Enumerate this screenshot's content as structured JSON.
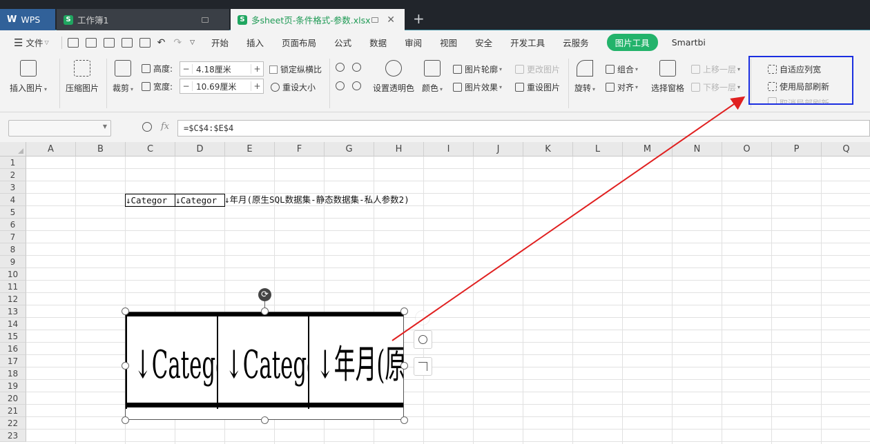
{
  "tabs": {
    "wps": "WPS",
    "book1": "工作簿1",
    "active": "多sheet页-条件格式-参数.xlsx",
    "new_tab_symbol": "+"
  },
  "menu": {
    "file": "文件",
    "items": [
      "开始",
      "插入",
      "页面布局",
      "公式",
      "数据",
      "审阅",
      "视图",
      "安全",
      "开发工具",
      "云服务"
    ],
    "active_tool": "图片工具",
    "smartbi": "Smartbi"
  },
  "ribbon": {
    "insert_picture": "插入图片",
    "compress_picture": "压缩图片",
    "crop": "裁剪",
    "height_label": "高度:",
    "height_value": "4.18厘米",
    "width_label": "宽度:",
    "width_value": "10.69厘米",
    "lock_ratio": "锁定纵横比",
    "reset_size": "重设大小",
    "set_transparent": "设置透明色",
    "color": "颜色",
    "picture_outline": "图片轮廓",
    "picture_effect": "图片效果",
    "change_picture": "更改图片",
    "reset_picture": "重设图片",
    "rotate": "旋转",
    "group": "组合",
    "align": "对齐",
    "selection_pane": "选择窗格",
    "bring_forward": "上移一层",
    "send_backward": "下移一层",
    "autofit_column": "自适应列宽",
    "use_partial_refresh": "使用局部刷新",
    "cancel_partial_refresh": "取消局部刷新"
  },
  "formula_bar": {
    "fx": "fx",
    "formula": "=$C$4:$E$4"
  },
  "sheet": {
    "columns": [
      "A",
      "B",
      "C",
      "D",
      "E",
      "F",
      "G",
      "H",
      "I",
      "J",
      "K",
      "L",
      "M",
      "N",
      "O",
      "P",
      "Q"
    ],
    "rows": [
      "1",
      "2",
      "3",
      "4",
      "5",
      "6",
      "7",
      "8",
      "9",
      "10",
      "11",
      "12",
      "13",
      "14",
      "15",
      "16",
      "17",
      "18",
      "19",
      "20",
      "21",
      "22",
      "23"
    ],
    "c4": "↓Categor",
    "d4": "↓Categor",
    "e4": "↓年月(原生SQL数据集-静态数据集-私人参数2)"
  },
  "picture": {
    "cell1": "↓Categor",
    "cell2": "↓Categor",
    "cell3": "↓年月(原"
  },
  "colors": {
    "accent_green": "#23b36b",
    "highlight_box": "#1a2ee0",
    "arrow": "#e02020"
  }
}
